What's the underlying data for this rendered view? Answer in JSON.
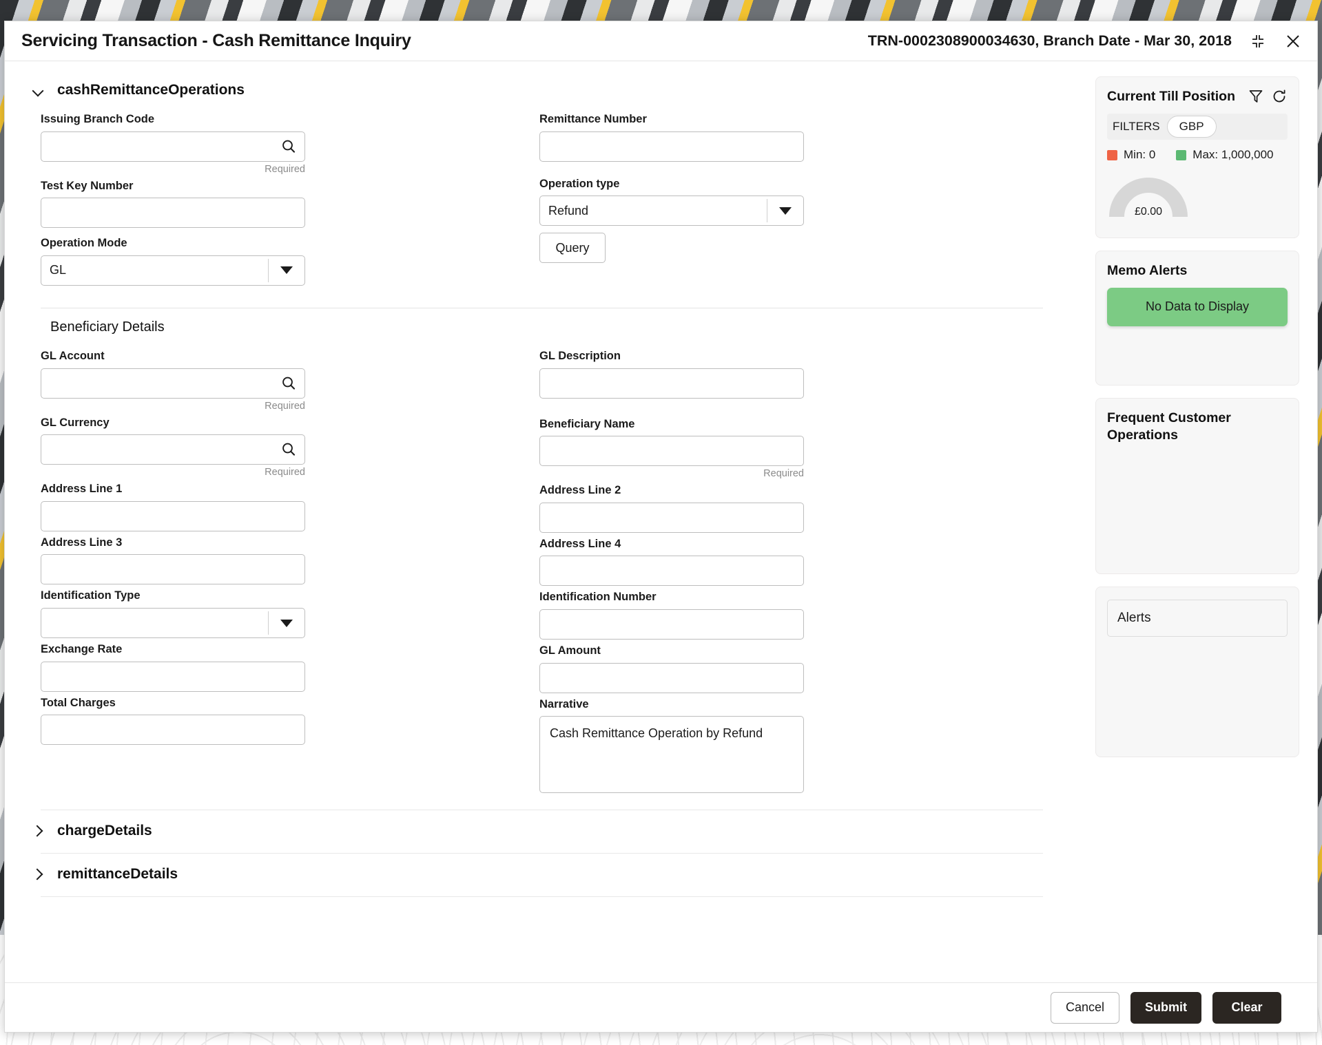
{
  "titlebar": {
    "title": "Servicing Transaction - Cash Remittance Inquiry",
    "trn": "TRN-0002308900034630, Branch Date - Mar 30, 2018",
    "minimize_icon": "collapse-icon",
    "close_icon": "close-icon"
  },
  "accordions": {
    "main": "cashRemittanceOperations",
    "charge": "chargeDetails",
    "remittance": "remittanceDetails"
  },
  "sections": {
    "beneficiary_title": "Beneficiary Details"
  },
  "top_form": {
    "issuing_branch_code": {
      "label": "Issuing Branch Code",
      "value": "",
      "required_text": "Required",
      "icon": "search-icon"
    },
    "test_key_number": {
      "label": "Test Key Number",
      "value": ""
    },
    "operation_mode": {
      "label": "Operation Mode",
      "value": "GL",
      "icon": "chevron-down-icon"
    },
    "remittance_number": {
      "label": "Remittance Number",
      "value": ""
    },
    "operation_type": {
      "label": "Operation type",
      "value": "Refund",
      "icon": "chevron-down-icon"
    },
    "query_button": "Query"
  },
  "beneficiary_form": {
    "gl_account": {
      "label": "GL Account",
      "value": "",
      "required_text": "Required",
      "icon": "search-icon"
    },
    "gl_currency": {
      "label": "GL Currency",
      "value": "",
      "required_text": "Required",
      "icon": "search-icon"
    },
    "address_line_1": {
      "label": "Address Line 1",
      "value": ""
    },
    "address_line_3": {
      "label": "Address Line 3",
      "value": ""
    },
    "identification_type": {
      "label": "Identification Type",
      "value": "",
      "icon": "chevron-down-icon"
    },
    "exchange_rate": {
      "label": "Exchange Rate",
      "value": ""
    },
    "total_charges": {
      "label": "Total Charges",
      "value": ""
    },
    "gl_description": {
      "label": "GL Description",
      "value": ""
    },
    "beneficiary_name": {
      "label": "Beneficiary Name",
      "value": "",
      "required_text": "Required"
    },
    "address_line_2": {
      "label": "Address Line 2",
      "value": ""
    },
    "address_line_4": {
      "label": "Address Line 4",
      "value": ""
    },
    "identification_number": {
      "label": "Identification Number",
      "value": ""
    },
    "gl_amount": {
      "label": "GL Amount",
      "value": ""
    },
    "narrative": {
      "label": "Narrative",
      "value": "Cash Remittance Operation by Refund"
    }
  },
  "sidebar": {
    "till": {
      "title": "Current Till Position",
      "filter_icon": "filter-icon",
      "refresh_icon": "refresh-icon",
      "filters_label": "FILTERS",
      "currency": "GBP",
      "min_label": "Min: 0",
      "max_label": "Max: 1,000,000",
      "min_color": "#ef6345",
      "max_color": "#5cb973",
      "gauge_value": "£0.00",
      "gauge_color": "#d7d7d7"
    },
    "memo": {
      "title": "Memo Alerts",
      "empty_text": "No Data to Display",
      "empty_color": "#7ccb84"
    },
    "frequent": {
      "title": "Frequent Customer Operations"
    },
    "alerts": {
      "box_label": "Alerts"
    }
  },
  "footer": {
    "cancel": "Cancel",
    "submit": "Submit",
    "clear": "Clear"
  }
}
